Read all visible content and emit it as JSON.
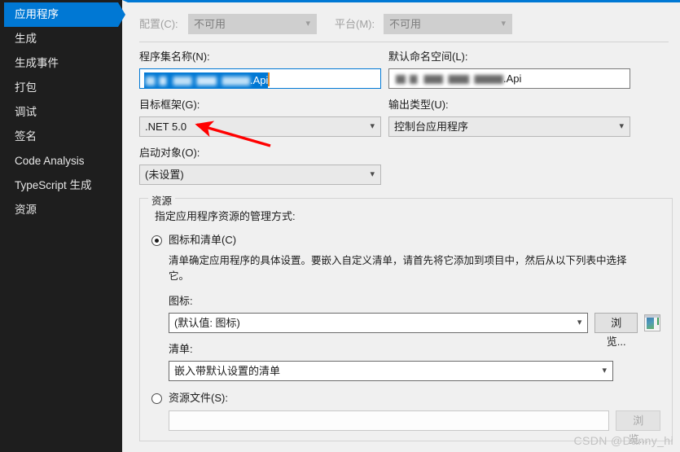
{
  "window": {
    "accent_color": "#0078d4",
    "sidebar_bg": "#1e1e1e",
    "pane_bg": "#f0f0f0"
  },
  "sidebar": {
    "items": [
      {
        "label": "应用程序",
        "selected": true
      },
      {
        "label": "生成",
        "selected": false
      },
      {
        "label": "生成事件",
        "selected": false
      },
      {
        "label": "打包",
        "selected": false
      },
      {
        "label": "调试",
        "selected": false
      },
      {
        "label": "签名",
        "selected": false
      },
      {
        "label": "Code Analysis",
        "selected": false
      },
      {
        "label": "TypeScript 生成",
        "selected": false
      },
      {
        "label": "资源",
        "selected": false
      }
    ]
  },
  "main": {
    "configuration": {
      "label": "配置(C):",
      "value": "不可用",
      "enabled": false
    },
    "platform": {
      "label": "平台(M):",
      "value": "不可用",
      "enabled": false
    },
    "assembly_name": {
      "label": "程序集名称(N):",
      "value_suffix": ".Api",
      "redacted": true,
      "selected": true
    },
    "default_namespace": {
      "label": "默认命名空间(L):",
      "value_suffix": ".Api",
      "redacted": true
    },
    "target_framework": {
      "label": "目标框架(G):",
      "value": ".NET 5.0"
    },
    "output_type": {
      "label": "输出类型(U):",
      "value": "控制台应用程序"
    },
    "startup_object": {
      "label": "启动对象(O):",
      "value": "(未设置)"
    },
    "resources": {
      "group_title": "资源",
      "description": "指定应用程序资源的管理方式:",
      "icon_manifest_option": {
        "label": "图标和清单(C)",
        "selected": true,
        "help_text": "清单确定应用程序的具体设置。要嵌入自定义清单，请首先将它添加到项目中，然后从以下列表中选择它。",
        "icon": {
          "label": "图标:",
          "value": "(默认值: 图标)",
          "browse_label": "浏览...",
          "preview_icon_name": "icon-preview-thumbnail"
        },
        "manifest": {
          "label": "清单:",
          "value": "嵌入带默认设置的清单"
        }
      },
      "resource_file_option": {
        "label": "资源文件(S):",
        "selected": false,
        "value": "",
        "browse_label": "浏览...",
        "browse_enabled": false
      }
    }
  },
  "annotation": {
    "arrow_color": "#ff0000",
    "points_at": ".NET 5.0"
  },
  "watermark": {
    "text": "CSDN @Danny_hi"
  }
}
